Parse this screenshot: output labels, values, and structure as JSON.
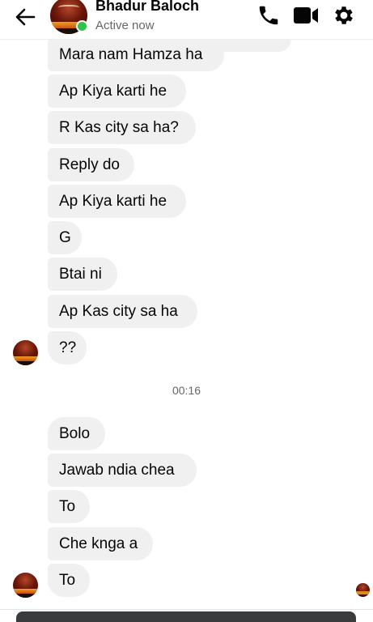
{
  "header": {
    "back_icon": "arrow-left-icon",
    "contact_name": "Bhadur Baloch",
    "status": "Active now",
    "status_color": "#31c24d",
    "actions": [
      "phone-icon",
      "video-camera-icon",
      "gear-icon"
    ]
  },
  "messages_group_1": [
    {
      "text": "Mara nam Hamza ha"
    },
    {
      "text": "Ap Kiya karti he"
    },
    {
      "text": "R Kas city sa ha?"
    },
    {
      "text": "Reply do"
    },
    {
      "text": "Ap Kiya karti he"
    },
    {
      "text": "G"
    },
    {
      "text": "Btai ni"
    },
    {
      "text": "Ap Kas city sa ha"
    },
    {
      "text": "??"
    }
  ],
  "timestamp": "00:16",
  "messages_group_2": [
    {
      "text": "Bolo"
    },
    {
      "text": "Jawab ndia chea"
    },
    {
      "text": "To"
    },
    {
      "text": "Che knga a"
    },
    {
      "text": "To"
    }
  ],
  "colors": {
    "bubble": "#f0f0f0",
    "text": "#050505",
    "muted": "#65676b"
  }
}
